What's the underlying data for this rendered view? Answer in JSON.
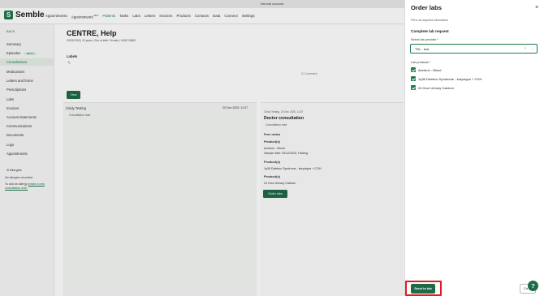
{
  "topbar": {
    "text": "Internal account"
  },
  "brand": {
    "mark": "S",
    "name": "Semble"
  },
  "nav": {
    "items": [
      "Appointments",
      "Appointments",
      "Patients",
      "Tasks",
      "Labs",
      "Letters",
      "Invoices",
      "Products",
      "Contacts",
      "Data",
      "Connect",
      "Settings"
    ],
    "new_badge": "NEW",
    "active_index": 2
  },
  "sidebar": {
    "back": "BACK",
    "items": [
      "Summary",
      "Episodes",
      "Consultations",
      "Medications",
      "Letters and forms",
      "Prescriptions",
      "Labs",
      "Invoices",
      "Account statements",
      "Communications",
      "Documents",
      "Logs",
      "Appointments"
    ],
    "episodes_badge": "BETA",
    "active_index": 2,
    "allergies_heading": "Allergies",
    "no_allergies": "No allergies recorded",
    "add_allergy_prefix": "To add an allergy",
    "add_allergy_link": "create a new consultation note."
  },
  "patient": {
    "name": "CENTRE, Help",
    "meta": "03/03/2003 | 22 years | Sex at birth: Female | 3436726650"
  },
  "labels_section": {
    "heading": "Labels"
  },
  "comment_link": "Comment",
  "view_button": "View",
  "consultation_entry": {
    "name": "Cindy Testing",
    "date": "20 Dec 2025, 11:07",
    "sub": "Consultation note"
  },
  "detail": {
    "meta": "Cindy Testing, 20 Dec 2025, 11:07",
    "title": "Doctor consultation",
    "tag": "Consultation note",
    "free_notes": "Free notes",
    "products": [
      {
        "heading": "Product(s)",
        "line1": "Acetone - Blood",
        "line2": "Sample date: 03/12/2025, Fasting"
      },
      {
        "heading": "Product(s)",
        "line1": "1q36 Deletion Syndrome - karyotype + CGH"
      },
      {
        "heading": "Product(s)",
        "line1": "24 Hour Urinary Calcium"
      }
    ],
    "order_button": "Order labs"
  },
  "drawer": {
    "title": "Order labs",
    "subtitle": "Fill in all required information",
    "section": "Complete lab request",
    "provider_label": "Select lab provider *",
    "provider_value": "TDL - test",
    "products_label": "Lab products *",
    "products": [
      "Acetone - Blood",
      "1q36 Deletion Syndrome - karyotype + CGH",
      "24 Hour Urinary Calcium"
    ],
    "send_button": "Send to lab",
    "cancel_button": "Ca",
    "help": "?"
  },
  "colors": {
    "brand_green": "#1f6b48",
    "highlight_red": "#e21b1b"
  }
}
